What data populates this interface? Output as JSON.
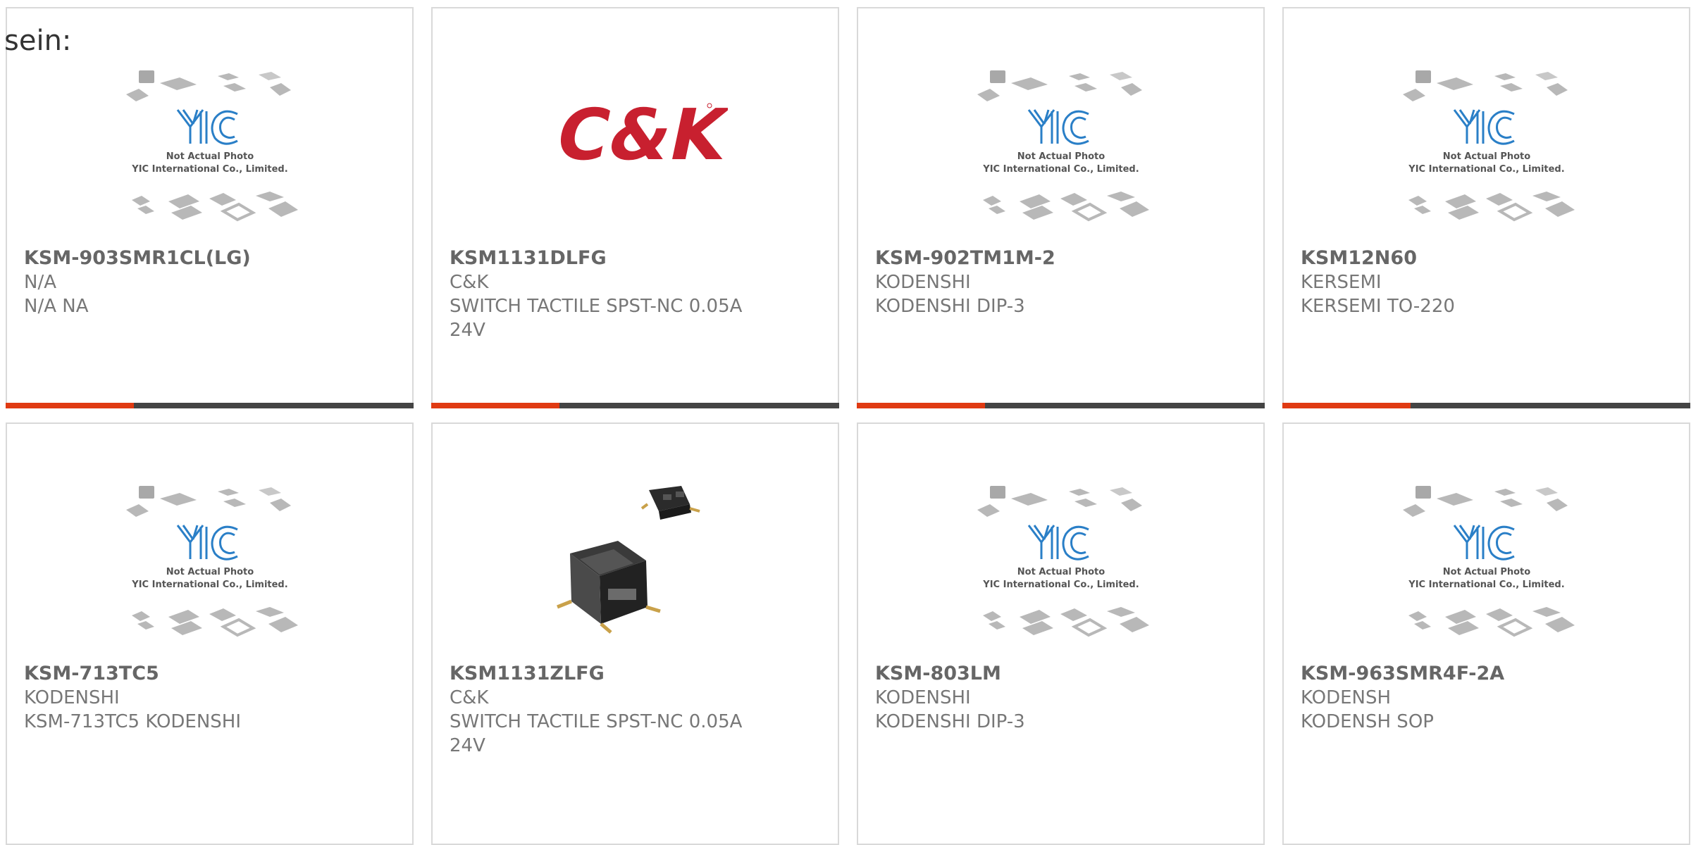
{
  "page": {
    "label": "sein:"
  },
  "colors": {
    "accent": "#e03a12",
    "bar": "#444444",
    "text": "#777777",
    "yic_blue": "#2a7fc7"
  },
  "products": [
    {
      "part": "KSM-903SMR1CL(LG)",
      "mfr": "N/A",
      "desc": "N/A NA",
      "image": "yic-placeholder",
      "placeholder": {
        "line1": "Not Actual Photo",
        "line2": "YIC International Co., Limited."
      }
    },
    {
      "part": "KSM1131DLFG",
      "mfr": "C&K",
      "desc": "SWITCH TACTILE SPST-NC 0.05A 24V",
      "image": "ck-logo",
      "logo_text": "C&K"
    },
    {
      "part": "KSM-902TM1M-2",
      "mfr": "KODENSHI",
      "desc": "KODENSHI DIP-3",
      "image": "yic-placeholder",
      "placeholder": {
        "line1": "Not Actual Photo",
        "line2": "YIC International Co., Limited."
      }
    },
    {
      "part": "KSM12N60",
      "mfr": "KERSEMI",
      "desc": "KERSEMI TO-220",
      "image": "yic-placeholder",
      "placeholder": {
        "line1": "Not Actual Photo",
        "line2": "YIC International Co., Limited."
      }
    },
    {
      "part": "KSM-713TC5",
      "mfr": "KODENSHI",
      "desc": "KSM-713TC5 KODENSHI",
      "image": "yic-placeholder",
      "placeholder": {
        "line1": "Not Actual Photo",
        "line2": "YIC International Co., Limited."
      }
    },
    {
      "part": "KSM1131ZLFG",
      "mfr": "C&K",
      "desc": "SWITCH TACTILE SPST-NC 0.05A 24V",
      "image": "tactile-switch-photo"
    },
    {
      "part": "KSM-803LM",
      "mfr": "KODENSHI",
      "desc": "KODENSHI DIP-3",
      "image": "yic-placeholder",
      "placeholder": {
        "line1": "Not Actual Photo",
        "line2": "YIC International Co., Limited."
      }
    },
    {
      "part": "KSM-963SMR4F-2A",
      "mfr": "KODENSH",
      "desc": "KODENSH SOP",
      "image": "yic-placeholder",
      "placeholder": {
        "line1": "Not Actual Photo",
        "line2": "YIC International Co., Limited."
      }
    }
  ]
}
